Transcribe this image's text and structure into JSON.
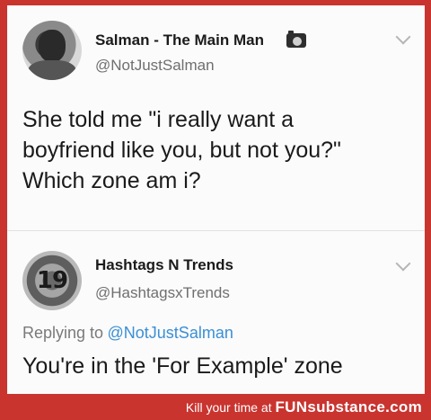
{
  "tweet": {
    "author_name": "Salman - The Main Man",
    "author_handle": "@NotJustSalman",
    "author_badge_icon": "camera-icon",
    "text_lines": [
      "She told me \"i really want a",
      "boyfriend like you, but not you?\"",
      "Which zone am i?"
    ]
  },
  "reply": {
    "author_name": "Hashtags N Trends",
    "author_handle": "@HashtagsxTrends",
    "avatar_label": "19",
    "replying_to_prefix": "Replying to",
    "replying_to_handle": "@NotJustSalman",
    "text": "You're in the 'For Example' zone"
  },
  "footer": {
    "tagline": "Kill your time at",
    "brand": "FUNsubstance.com"
  },
  "colors": {
    "frame_border": "#c9342f",
    "link": "#3a8fd6"
  }
}
